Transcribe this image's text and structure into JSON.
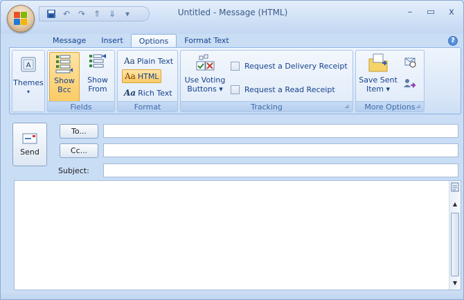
{
  "window": {
    "title": "Untitled - Message (HTML)",
    "controls": {
      "minimize": "–",
      "maximize": "▭",
      "close": "x"
    }
  },
  "quick_access": [
    {
      "name": "save-icon",
      "glyph": "▪"
    },
    {
      "name": "undo-icon",
      "glyph": "↶"
    },
    {
      "name": "redo-icon",
      "glyph": "↷"
    },
    {
      "name": "up-arrow-icon",
      "glyph": "⇑"
    },
    {
      "name": "down-arrow-icon",
      "glyph": "⇓"
    },
    {
      "name": "customize-icon",
      "glyph": "▾"
    }
  ],
  "tabs": [
    {
      "label": "Message",
      "active": false
    },
    {
      "label": "Insert",
      "active": false
    },
    {
      "label": "Options",
      "active": true
    },
    {
      "label": "Format Text",
      "active": false
    }
  ],
  "ribbon": {
    "themes": {
      "label": "Themes",
      "arrow": "▾"
    },
    "fields": {
      "group_label": "Fields",
      "show_bcc": {
        "line1": "Show",
        "line2": "Bcc",
        "pressed": true
      },
      "show_from": {
        "line1": "Show",
        "line2": "From",
        "pressed": false
      }
    },
    "format": {
      "group_label": "Format",
      "aa": "Aa",
      "plain_text": "Plain Text",
      "html": "HTML",
      "rich_text": "Rich Text",
      "selected": "html"
    },
    "tracking": {
      "group_label": "Tracking",
      "voting": {
        "line1": "Use Voting",
        "line2": "Buttons ▾"
      },
      "delivery_receipt": {
        "label": "Request a Delivery Receipt",
        "checked": false
      },
      "read_receipt": {
        "label": "Request a Read Receipt",
        "checked": false
      }
    },
    "more_options": {
      "group_label": "More Options",
      "save_sent": {
        "line1": "Save Sent",
        "line2": "Item ▾"
      }
    }
  },
  "header": {
    "send": "Send",
    "to": "To...",
    "cc": "Cc...",
    "subject_label": "Subject:",
    "to_value": "",
    "cc_value": "",
    "subject_value": ""
  },
  "body": {
    "text": ""
  },
  "colors": {
    "accent": "#15428b",
    "pressed": "#fbcb66",
    "ribbon_bg": "#dfeaf8"
  }
}
